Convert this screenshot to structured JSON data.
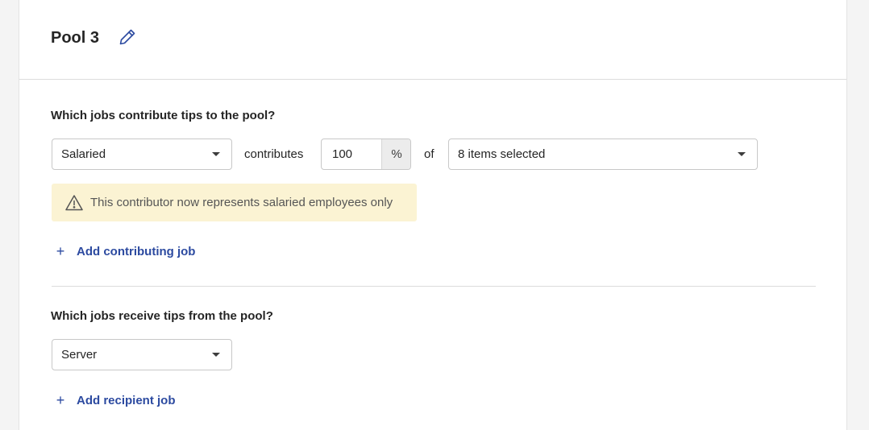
{
  "pool": {
    "title": "Pool 3",
    "edit_icon": "pencil-icon"
  },
  "contributors": {
    "question": "Which jobs contribute tips to the pool?",
    "job_select_value": "Salaried",
    "contributes_label": "contributes",
    "percent_value": "100",
    "percent_suffix": "%",
    "of_label": "of",
    "items_select_value": "8 items selected",
    "warning_text": "This contributor now represents salaried employees only",
    "warning_icon": "warning-triangle-icon",
    "add_label": "Add contributing job"
  },
  "recipients": {
    "question": "Which jobs receive tips from the pool?",
    "job_select_value": "Server",
    "add_label": "Add recipient job"
  },
  "colors": {
    "link": "#2c4aa0",
    "warning_bg": "#fbf3d3",
    "border": "#c8c8c8"
  }
}
